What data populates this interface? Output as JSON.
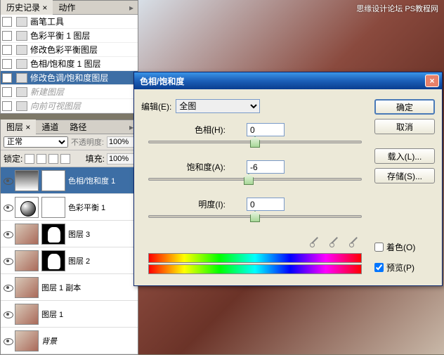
{
  "watermark": "思缘设计论坛  PS教程网",
  "history": {
    "tab_history": "历史记录 ×",
    "tab_actions": "动作",
    "items": [
      {
        "label": "画笔工具"
      },
      {
        "label": "色彩平衡 1 图层"
      },
      {
        "label": "修改色彩平衡图层"
      },
      {
        "label": "色相/饱和度 1 图层"
      },
      {
        "label": "修改色调/饱和度图层",
        "selected": true
      },
      {
        "label": "新建图层",
        "dim": true
      },
      {
        "label": "向前可视图层",
        "dim": true
      }
    ]
  },
  "layers": {
    "tab_layers": "图层 ×",
    "tab_channels": "通道",
    "tab_paths": "路径",
    "blend_mode": "正常",
    "opacity_label": "不透明度:",
    "opacity_value": "100%",
    "lock_label": "锁定:",
    "fill_label": "填充:",
    "fill_value": "100%",
    "items": [
      {
        "name": "色相/饱和度 1",
        "selected": true
      },
      {
        "name": "色彩平衡 1"
      },
      {
        "name": "图层 3"
      },
      {
        "name": "图层 2"
      },
      {
        "name": "图层 1 副本"
      },
      {
        "name": "图层 1"
      },
      {
        "name": "背景"
      }
    ]
  },
  "dialog": {
    "title": "色相/饱和度",
    "edit_label": "编辑(E):",
    "edit_value": "全图",
    "hue_label": "色相(H):",
    "hue_value": "0",
    "sat_label": "饱和度(A):",
    "sat_value": "-6",
    "light_label": "明度(I):",
    "light_value": "0",
    "btn_ok": "确定",
    "btn_cancel": "取消",
    "btn_load": "载入(L)...",
    "btn_save": "存储(S)...",
    "chk_colorize": "着色(O)",
    "chk_preview": "预览(P)"
  }
}
